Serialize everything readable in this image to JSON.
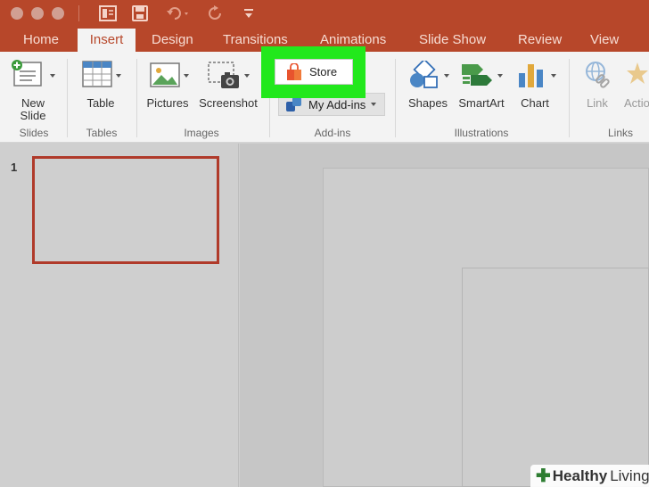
{
  "window": {
    "buttons": [
      "close",
      "minimize",
      "zoom"
    ],
    "colors": {
      "close": "#fc5f57",
      "minimize": "#fdbc2e",
      "zoom": "#27c840",
      "brand": "#b7472a"
    }
  },
  "quick_access": {
    "icons": [
      "layout-icon",
      "save-icon",
      "undo-icon",
      "redo-icon",
      "customize-icon"
    ]
  },
  "tabs": [
    {
      "label": "Home"
    },
    {
      "label": "Insert"
    },
    {
      "label": "Design"
    },
    {
      "label": "Transitions"
    },
    {
      "label": "Animations"
    },
    {
      "label": "Slide Show"
    },
    {
      "label": "Review"
    },
    {
      "label": "View"
    }
  ],
  "ribbon": {
    "groups": {
      "slides": "Slides",
      "tables": "Tables",
      "images": "Images",
      "addins": "Add-ins",
      "illustrations": "Illustrations",
      "links": "Links"
    },
    "buttons": {
      "new_slide_1": "New",
      "new_slide_2": "Slide",
      "table": "Table",
      "pictures": "Pictures",
      "screenshot": "Screenshot",
      "store": "Store",
      "my_addins": "My Add-ins",
      "shapes": "Shapes",
      "smartart": "SmartArt",
      "chart": "Chart",
      "link": "Link",
      "action": "Actio"
    }
  },
  "slide_panel": {
    "slide_number": "1"
  },
  "watermark": {
    "part1": "Healthy",
    "part2": "Living"
  }
}
